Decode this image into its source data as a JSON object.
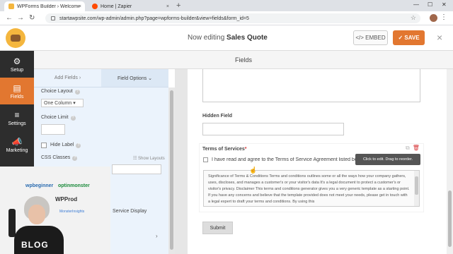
{
  "browser": {
    "tabs": [
      {
        "title": "WPForms Builder › Welcome — V",
        "close": "×"
      },
      {
        "title": "Home | Zapier",
        "close": "×"
      }
    ],
    "new_tab": "+",
    "window_controls": {
      "minimize": "—",
      "maximize": "☐",
      "close": "✕"
    },
    "nav": {
      "back": "←",
      "forward": "→",
      "reload": "↻"
    },
    "url": "startawpsite.com/wp-admin/admin.php?page=wpforms-builder&view=fields&form_id=5",
    "bookmark_icon": "☆",
    "menu_icon": "⋮"
  },
  "header": {
    "editing_prefix": "Now editing",
    "form_name": "Sales Quote",
    "embed_label": "</> EMBED",
    "save_label": "✓ SAVE",
    "close_icon": "×"
  },
  "sidebar": {
    "items": [
      {
        "label": "Setup",
        "icon": "⚙"
      },
      {
        "label": "Fields",
        "icon": "▤"
      },
      {
        "label": "Settings",
        "icon": "≡"
      },
      {
        "label": "Marketing",
        "icon": "📣"
      },
      {
        "label": "",
        "icon": "$"
      }
    ]
  },
  "fields_bar": {
    "title": "Fields"
  },
  "panel": {
    "tabs": [
      {
        "label": "Add Fields ›"
      },
      {
        "label": "Field Options ⌄"
      }
    ],
    "choice_layout_label": "Choice Layout",
    "choice_layout_value": "One Column ▾",
    "choice_limit_label": "Choice Limit",
    "hide_label": "Hide Label",
    "css_classes_label": "CSS Classes",
    "show_layouts": "☷ Show Layouts",
    "service_display": "Service Display",
    "chevron": "›",
    "help_icon": "?"
  },
  "webcam": {
    "logo_a": "wpbeginner",
    "logo_b": "optinmonster",
    "logo_c": "WPProd",
    "logo_d": "MonsterInsights",
    "shirt": "BLOG"
  },
  "preview": {
    "hidden_field_label": "Hidden Field",
    "tos_label": "Terms of Services",
    "required_marker": "*",
    "duplicate_icon": "⧉",
    "delete_icon": "🗑",
    "tos_agree": "I have read and agree to the Terms of Service Agreement listed below",
    "tooltip": "Click to edit. Drag to reorder.",
    "tos_text": "Significance of Terms & Conditions Terms and conditions outlines some or all the ways how your company gathers, uses, discloses, and manages a customer's or your visitor's data It's a legal document to protect a customer's or visitor's privacy. Disclaimer This terms and conditions generator gives you a very generic template as a starting point. If you have any concerns and believe that the template provided does not meet your needs, please get in touch with a legal expert to draft your terms and conditions. By using this",
    "submit_label": "Submit",
    "cursor": "☝"
  }
}
